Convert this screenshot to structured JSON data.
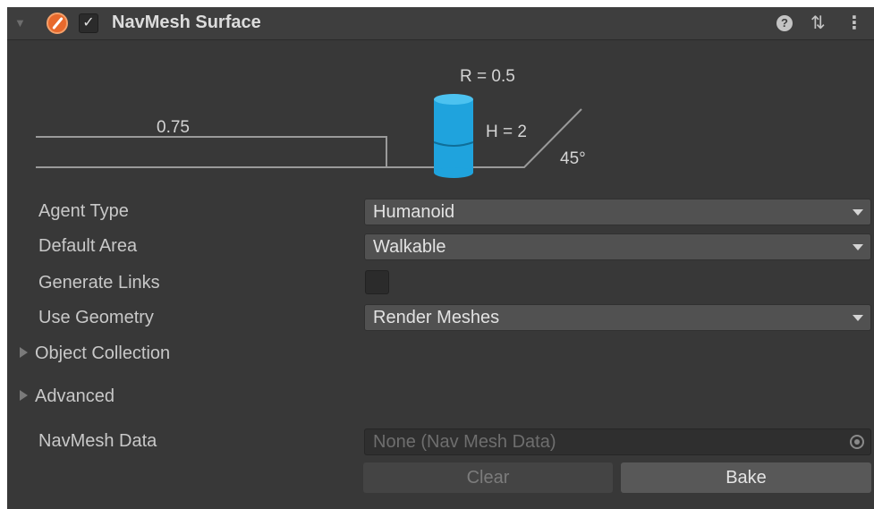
{
  "component": {
    "title": "NavMesh Surface",
    "enabled_check": "✓",
    "help_icon": "help-icon",
    "presets_icon": "presets-icon",
    "menu_icon": "context-menu-icon"
  },
  "diagram": {
    "step_height": "0.75",
    "radius": "R = 0.5",
    "height": "H = 2",
    "slope": "45°"
  },
  "properties": {
    "agent_type": {
      "label": "Agent Type",
      "value": "Humanoid"
    },
    "default_area": {
      "label": "Default Area",
      "value": "Walkable"
    },
    "generate_links": {
      "label": "Generate Links",
      "checked": false
    },
    "use_geometry": {
      "label": "Use Geometry",
      "value": "Render Meshes"
    }
  },
  "foldouts": {
    "object_collection": "Object Collection",
    "advanced": "Advanced"
  },
  "navmesh_data": {
    "label": "NavMesh Data",
    "value": "None (Nav Mesh Data)"
  },
  "buttons": {
    "clear": "Clear",
    "bake": "Bake"
  },
  "colors": {
    "panel_bg": "#383838",
    "header_bg": "#3e3e3e",
    "agent_cylinder": "#1fa3dd",
    "component_icon": "#e8692c"
  }
}
